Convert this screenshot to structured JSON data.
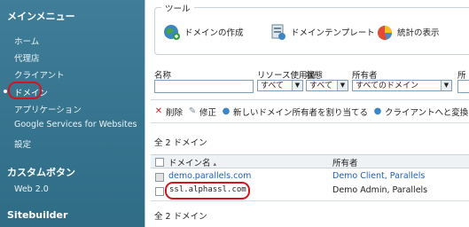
{
  "sidebar": {
    "main_menu_title": "メインメニュー",
    "items": [
      {
        "label": "ホーム"
      },
      {
        "label": "代理店"
      },
      {
        "label": "クライアント"
      },
      {
        "label": "ドメイン"
      },
      {
        "label": "アプリケーション"
      },
      {
        "label": "Google Services for Websites"
      },
      {
        "label": "設定"
      }
    ],
    "custom_buttons_title": "カスタムボタン",
    "custom_items": [
      {
        "label": "Web 2.0"
      }
    ],
    "sitebuilder_title": "Sitebuilder"
  },
  "tools": {
    "title": "ツール",
    "items": [
      {
        "label": "ドメインの作成",
        "icon": "globe-plus-icon"
      },
      {
        "label": "ドメインテンプレート",
        "icon": "template-icon"
      },
      {
        "label": "統計の表示",
        "icon": "pie-chart-icon"
      }
    ]
  },
  "filters": {
    "name_label": "名称",
    "resource_label": "リソース使用量",
    "status_label": "状態",
    "owner_label": "所有者",
    "cut_label": "所",
    "resource_value": "すべて",
    "status_value": "すべて",
    "owner_value": "すべてのドメイン"
  },
  "actions": {
    "delete": "削除",
    "edit": "修正",
    "assign_owner": "新しいドメイン所有者を割り当てる",
    "convert": "クライアントへと変換"
  },
  "list": {
    "count_top": "全 2 ドメイン",
    "count_bottom": "全 2 ドメイン",
    "columns": {
      "domain": "ドメイン名",
      "owner": "所有者"
    },
    "rows": [
      {
        "domain": "demo.parallels.com",
        "owner": "Demo Client, Parallels"
      },
      {
        "domain": "ssl.alphassl.com",
        "owner": "Demo Admin, Parallels"
      }
    ]
  },
  "colors": {
    "sidebar_bg": "#3a7893",
    "highlight": "#d6141e",
    "link": "#1f5fb3"
  }
}
